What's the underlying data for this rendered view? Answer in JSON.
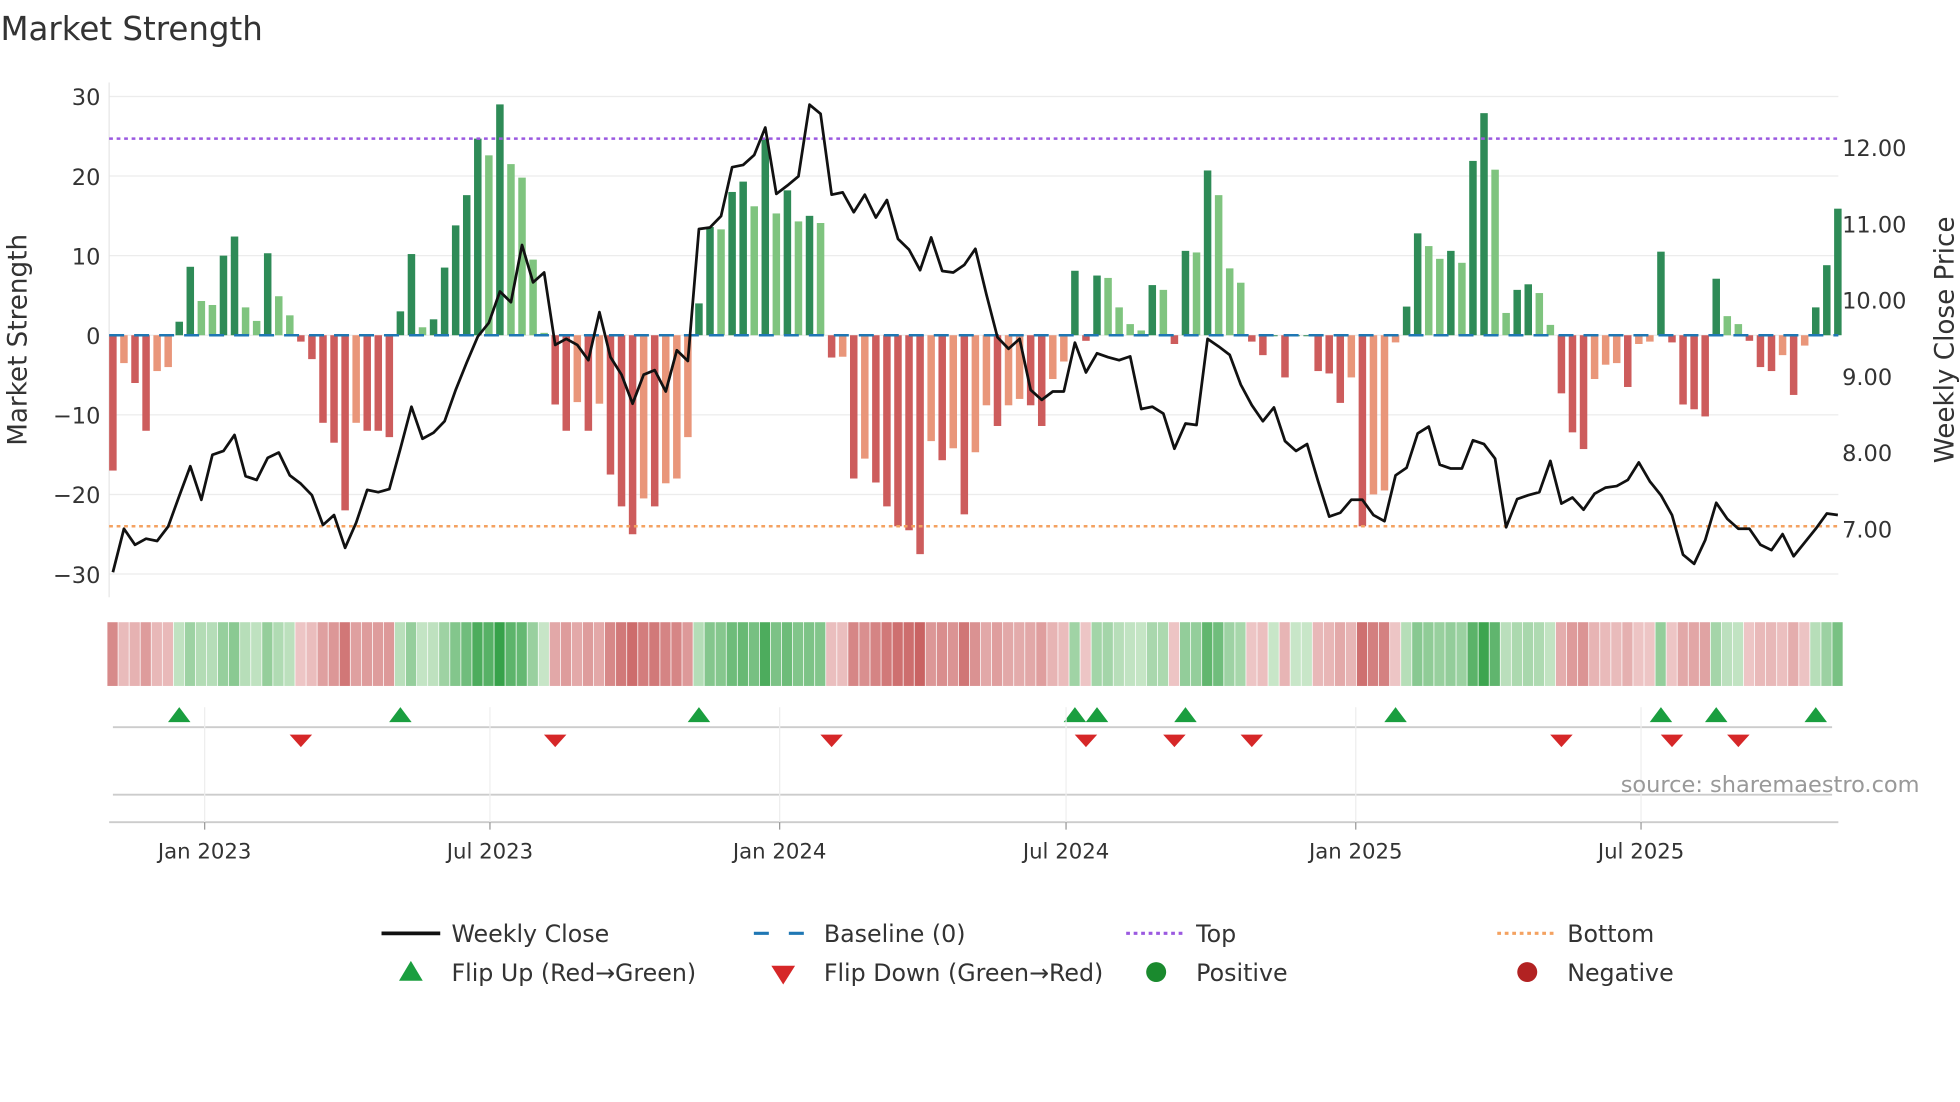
{
  "chart_data": {
    "type": "bar",
    "title": "Market Strength",
    "ylabel": "Market Strength",
    "y2label": "Weekly Close Price",
    "ylim": [
      -31.5,
      30.5
    ],
    "y2lim": [
      6.25,
      12.72
    ],
    "yticks": [
      "30",
      "20",
      "10",
      "0",
      "−10",
      "−20",
      "−30"
    ],
    "ytick_values": [
      30,
      20,
      10,
      0,
      -10,
      -20,
      -30
    ],
    "y2ticks": [
      "12.00",
      "11.00",
      "10.00",
      "9.00",
      "8.00",
      "7.00"
    ],
    "y2tick_values": [
      12,
      11,
      10,
      9,
      8,
      7
    ],
    "xticks": [
      "Jan 2023",
      "Jul 2023",
      "Jan 2024",
      "Jul 2024",
      "Jan 2025",
      "Jul 2025"
    ],
    "xtick_weeks": [
      8.3,
      34.1,
      60.3,
      86.2,
      112.4,
      138.2
    ],
    "top_level": 24.7,
    "bottom_level": -24,
    "baseline": 0,
    "strength": [
      -17,
      -3.5,
      -6,
      -12,
      -4.5,
      -4,
      1.7,
      8.6,
      4.3,
      3.8,
      10,
      12.4,
      3.5,
      1.8,
      10.3,
      4.9,
      2.5,
      -0.8,
      -3,
      -11,
      -13.5,
      -22,
      -11,
      -12,
      -12,
      -12.8,
      3,
      10.2,
      1,
      2,
      8.5,
      13.8,
      17.6,
      24.7,
      22.6,
      29,
      21.5,
      19.8,
      9.5,
      0.3,
      -8.7,
      -12,
      -8.4,
      -12,
      -8.6,
      -17.5,
      -21.5,
      -25,
      -20.5,
      -21.5,
      -18.6,
      -18,
      -12.8,
      4,
      13.6,
      13.3,
      18,
      19.3,
      16.2,
      24.7,
      15.3,
      18.2,
      14.3,
      15,
      14.1,
      -2.8,
      -2.7,
      -18,
      -15.5,
      -18.5,
      -21.5,
      -24,
      -24.5,
      -27.5,
      -13.3,
      -15.7,
      -14.2,
      -22.5,
      -14.7,
      -8.8,
      -11.4,
      -8.8,
      -8,
      -8.8,
      -11.4,
      -5.5,
      -3.3,
      8.1,
      -0.7,
      7.5,
      7.2,
      3.5,
      1.4,
      0.6,
      6.3,
      5.7,
      -1.1,
      10.6,
      10.4,
      20.7,
      17.6,
      8.4,
      6.6,
      -0.8,
      -2.5,
      0,
      -5.3,
      0,
      0,
      -4.5,
      -4.8,
      -8.5,
      -5.3,
      -24,
      -20,
      -19.5,
      -0.9,
      3.6,
      12.8,
      11.2,
      9.6,
      10.6,
      9.1,
      21.9,
      27.9,
      20.8,
      2.8,
      5.7,
      6.4,
      5.3,
      1.3,
      -7.3,
      -12.2,
      -14.3,
      -5.5,
      -3.7,
      -3.5,
      -6.5,
      -1.1,
      -0.8,
      10.5,
      -0.9,
      -8.7,
      -9.3,
      -10.2,
      7.1,
      2.4,
      1.4,
      -0.7,
      -4,
      -4.5,
      -2.5,
      -7.5,
      -1.3,
      3.5,
      8.8,
      15.9
    ],
    "weekly_close": [
      6.43,
      7.0,
      6.79,
      6.87,
      6.84,
      7.03,
      7.43,
      7.82,
      7.38,
      7.97,
      8.02,
      8.23,
      7.69,
      7.64,
      7.93,
      8.0,
      7.7,
      7.59,
      7.44,
      7.05,
      7.18,
      6.75,
      7.08,
      7.51,
      7.48,
      7.52,
      8.05,
      8.6,
      8.18,
      8.26,
      8.41,
      8.82,
      9.18,
      9.52,
      9.7,
      10.11,
      9.97,
      10.72,
      10.23,
      10.36,
      9.41,
      9.49,
      9.41,
      9.21,
      9.84,
      9.25,
      9.02,
      8.64,
      9.02,
      9.08,
      8.8,
      9.34,
      9.2,
      10.93,
      10.95,
      11.1,
      11.74,
      11.77,
      11.9,
      12.26,
      11.39,
      11.5,
      11.62,
      12.56,
      12.44,
      11.38,
      11.41,
      11.15,
      11.38,
      11.08,
      11.31,
      10.8,
      10.66,
      10.39,
      10.82,
      10.38,
      10.36,
      10.46,
      10.67,
      10.07,
      9.51,
      9.36,
      9.49,
      8.82,
      8.69,
      8.8,
      8.8,
      9.44,
      9.05,
      9.3,
      9.25,
      9.21,
      9.26,
      8.57,
      8.6,
      8.51,
      8.05,
      8.38,
      8.36,
      9.49,
      9.39,
      9.28,
      8.89,
      8.62,
      8.41,
      8.59,
      8.15,
      8.02,
      8.11,
      7.62,
      7.16,
      7.21,
      7.38,
      7.38,
      7.18,
      7.1,
      7.7,
      7.8,
      8.25,
      8.34,
      7.84,
      7.79,
      7.79,
      8.16,
      8.11,
      7.92,
      7.02,
      7.39,
      7.44,
      7.48,
      7.89,
      7.33,
      7.41,
      7.25,
      7.46,
      7.54,
      7.56,
      7.64,
      7.87,
      7.62,
      7.44,
      7.18,
      6.66,
      6.54,
      6.85,
      7.34,
      7.13,
      7.0,
      7.0,
      6.79,
      6.72,
      6.93,
      6.64,
      6.82,
      7.0,
      7.2,
      7.18
    ],
    "flip_up_weeks": [
      6,
      26,
      53,
      87,
      89,
      97,
      116,
      140,
      145,
      154
    ],
    "flip_down_weeks": [
      17,
      40,
      65,
      88,
      96,
      103,
      131,
      141,
      147
    ],
    "legend": [
      {
        "label": "Weekly Close",
        "symbol": "line-solid",
        "color": "#111111"
      },
      {
        "label": "Baseline (0)",
        "symbol": "line-dashed",
        "color": "#1f77b4"
      },
      {
        "label": "Top",
        "symbol": "line-dotted",
        "color": "#9b59e0"
      },
      {
        "label": "Bottom",
        "symbol": "line-dotted",
        "color": "#f4a261"
      },
      {
        "label": "Flip Up (Red→Green)",
        "symbol": "triangle-up",
        "color": "#1a9e3f"
      },
      {
        "label": "Flip Down (Green→Red)",
        "symbol": "triangle-down",
        "color": "#d62728"
      },
      {
        "label": "Positive",
        "symbol": "circle",
        "color": "#1a8a2e"
      },
      {
        "label": "Negative",
        "symbol": "circle",
        "color": "#b22222"
      }
    ],
    "legend_placement": "bottom",
    "grid": true
  },
  "source": "source: sharemaestro.com",
  "colors": {
    "pos_strong": "#2e8b57",
    "pos_weak": "#7fc47f",
    "neg_strong": "#cd5c5c",
    "neg_weak": "#e9967a"
  }
}
